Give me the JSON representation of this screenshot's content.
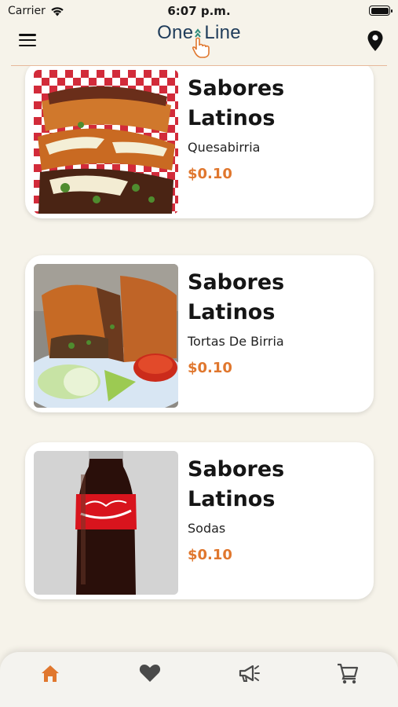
{
  "status_bar": {
    "carrier": "Carrier",
    "time": "6:07 p.m."
  },
  "header": {
    "logo_text_left": "One",
    "logo_text_right": "Line",
    "menu_icon": "hamburger-menu-icon",
    "location_icon": "map-pin-icon"
  },
  "colors": {
    "price": "#e0772e",
    "active_nav": "#e0772e",
    "inactive_nav": "#4a4a4a",
    "divider": "#e7b89a"
  },
  "items": [
    {
      "title_line1": "Sabores",
      "title_line2": "Latinos",
      "subtitle": "Quesabirria",
      "price": "$0.10",
      "image": "quesabirria-photo"
    },
    {
      "title_line1": "Sabores",
      "title_line2": "Latinos",
      "subtitle": "Tortas De Birria",
      "price": "$0.10",
      "image": "tortas-de-birria-photo"
    },
    {
      "title_line1": "Sabores",
      "title_line2": "Latinos",
      "subtitle": "Sodas",
      "price": "$0.10",
      "image": "coca-cola-bottle-photo"
    }
  ],
  "bottom_nav": [
    {
      "icon": "home-icon",
      "active": true
    },
    {
      "icon": "heart-icon",
      "active": false
    },
    {
      "icon": "megaphone-icon",
      "active": false
    },
    {
      "icon": "cart-icon",
      "active": false
    }
  ]
}
